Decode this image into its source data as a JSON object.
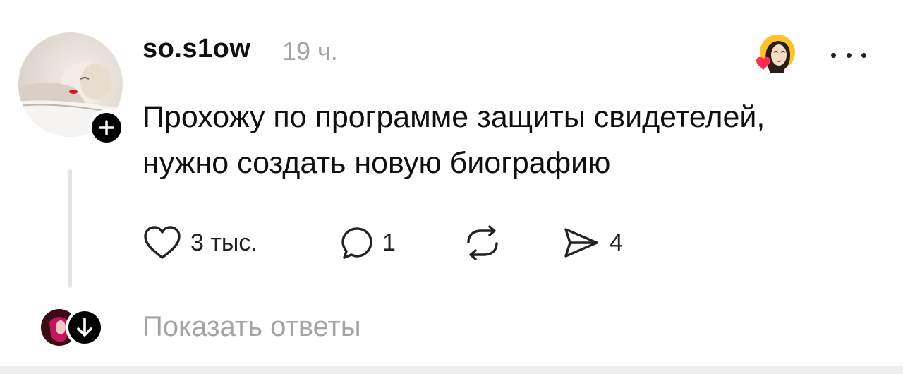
{
  "post": {
    "username": "so.s1ow",
    "timestamp": "19 ч.",
    "text_lines": [
      "Прохожу по программе защиты свидетелей,",
      "нужно создать новую биографию"
    ]
  },
  "actions": {
    "likes": "3 тыс.",
    "comments": "1",
    "reposts": "",
    "shares": "4"
  },
  "footer": {
    "show_replies_label": "Показать ответы"
  },
  "icons": {
    "like": "heart-outline-icon",
    "comment": "speech-bubble-icon",
    "repost": "repost-arrows-icon",
    "share": "paper-plane-icon",
    "follow": "plus-icon",
    "more": "ellipsis-icon",
    "expand": "arrow-down-icon"
  },
  "colors": {
    "text": "#101010",
    "muted": "#a4a4a4",
    "heart_badge": "#ff2d55"
  }
}
